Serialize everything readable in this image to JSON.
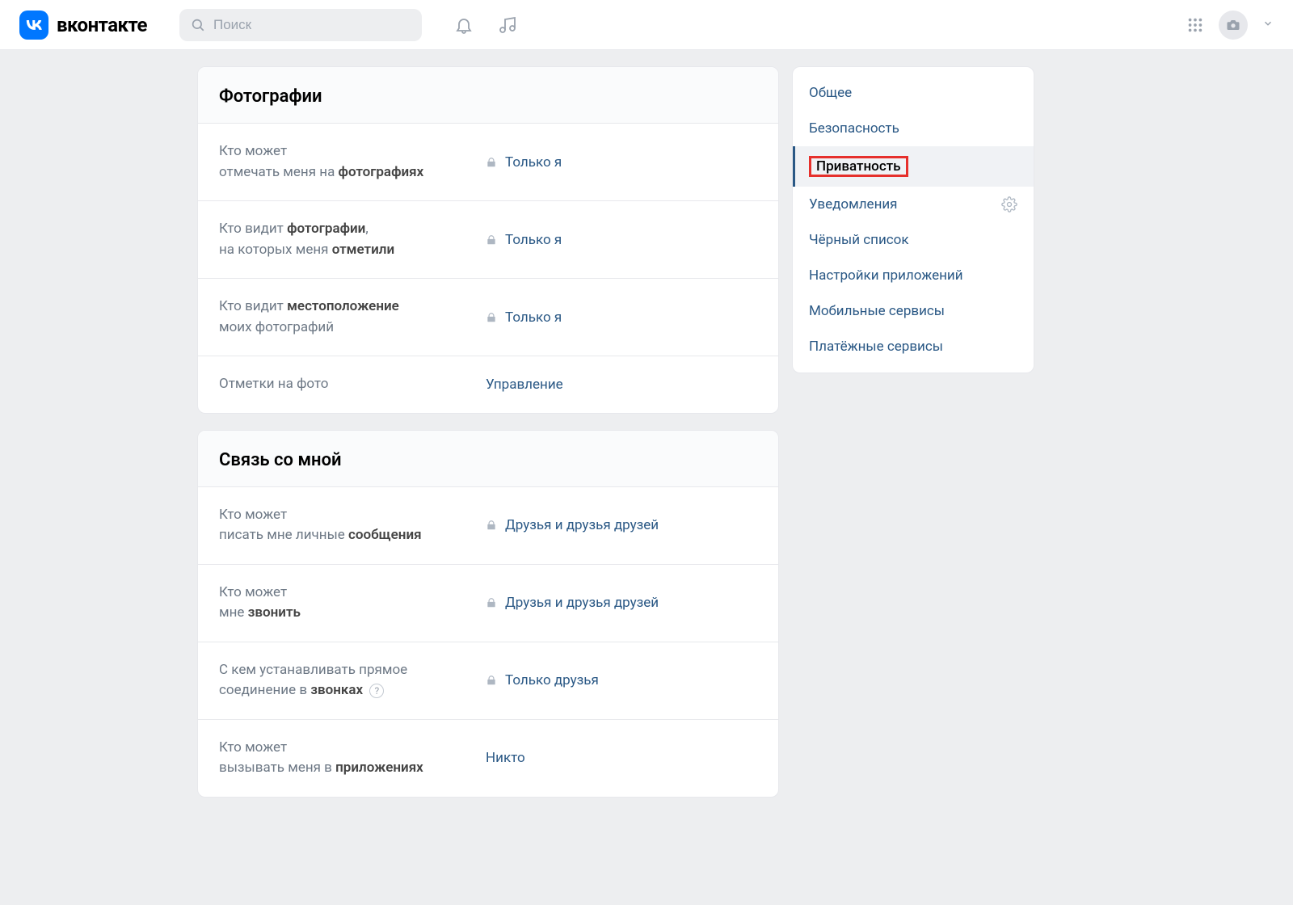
{
  "header": {
    "brand": "вконтакте",
    "logo_short": "VK",
    "search_placeholder": "Поиск"
  },
  "sections": [
    {
      "title": "Фотографии",
      "rows": [
        {
          "label_html": "Кто может<br>отмечать меня на <b>фотографиях</b>",
          "value": "Только я",
          "locked": true
        },
        {
          "label_html": "Кто видит <b>фотографии</b>,<br>на которых меня <b>отметили</b>",
          "value": "Только я",
          "locked": true
        },
        {
          "label_html": "Кто видит <b>местоположение</b><br>моих фотографий",
          "value": "Только я",
          "locked": true
        },
        {
          "label_html": "Отметки на фото",
          "value": "Управление",
          "locked": false
        }
      ]
    },
    {
      "title": "Связь со мной",
      "rows": [
        {
          "label_html": "Кто может<br>писать мне личные <b>сообщения</b>",
          "value": "Друзья и друзья друзей",
          "locked": true
        },
        {
          "label_html": "Кто может<br>мне <b>звонить</b>",
          "value": "Друзья и друзья друзей",
          "locked": true
        },
        {
          "label_html": "С кем устанавливать прямое<br>соединение в <b>звонках</b> <span class='help-icon'>?</span>",
          "value": "Только друзья",
          "locked": true
        },
        {
          "label_html": "Кто может<br>вызывать меня в <b>приложениях</b>",
          "value": "Никто",
          "locked": false
        }
      ]
    }
  ],
  "sidebar": {
    "items": [
      {
        "label": "Общее",
        "active": false,
        "gear": false
      },
      {
        "label": "Безопасность",
        "active": false,
        "gear": false
      },
      {
        "label": "Приватность",
        "active": true,
        "gear": false,
        "highlighted": true
      },
      {
        "label": "Уведомления",
        "active": false,
        "gear": true
      },
      {
        "label": "Чёрный список",
        "active": false,
        "gear": false
      },
      {
        "label": "Настройки приложений",
        "active": false,
        "gear": false
      },
      {
        "label": "Мобильные сервисы",
        "active": false,
        "gear": false
      },
      {
        "label": "Платёжные сервисы",
        "active": false,
        "gear": false
      }
    ]
  }
}
